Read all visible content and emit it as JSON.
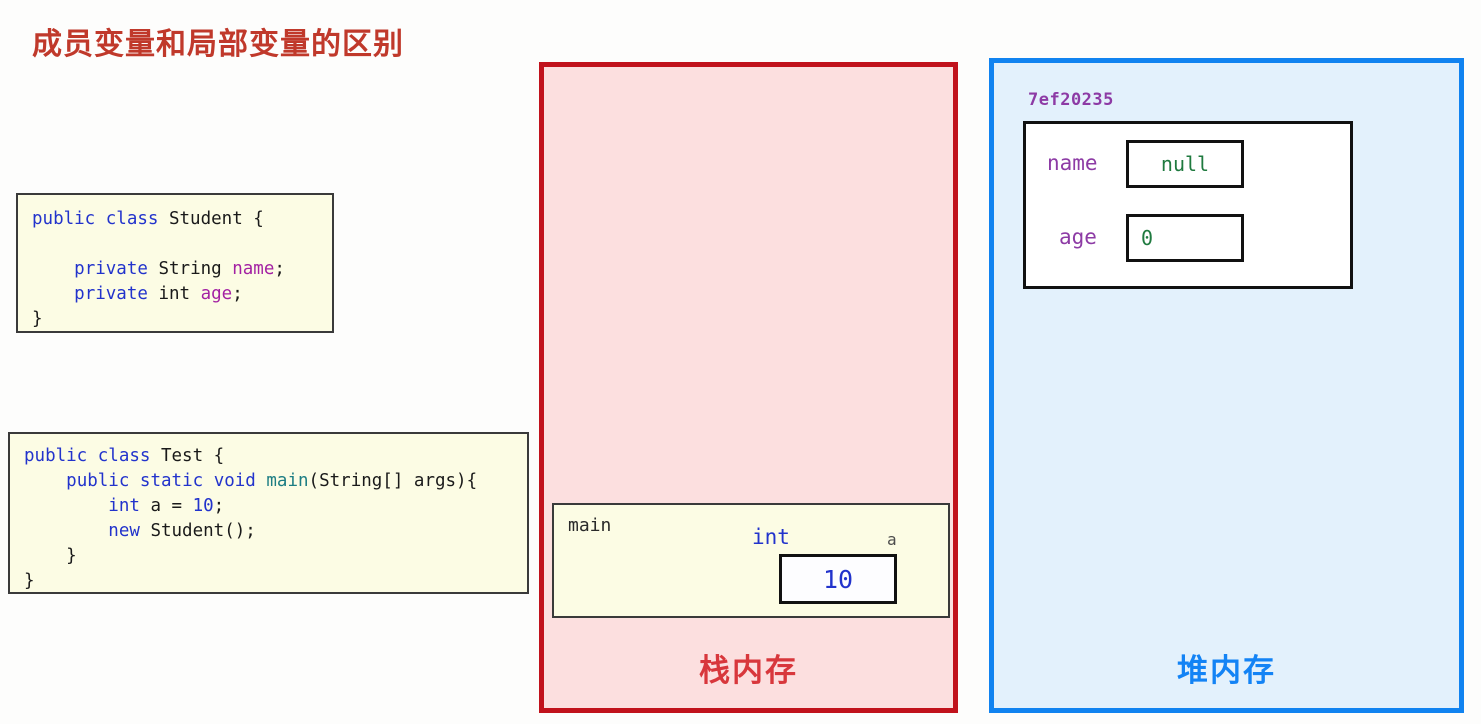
{
  "title": "成员变量和局部变量的区别",
  "colors": {
    "title": "#c0392b",
    "stack_border": "#c1121c",
    "stack_fill": "#fcdfdf",
    "heap_border": "#1183f0",
    "heap_fill": "#e3f1fc",
    "keyword": "#2233cc",
    "identifier": "#a321a3",
    "method": "#1c7d83",
    "heap_value": "#1f7a3f",
    "heap_address": "#8d3ba5"
  },
  "code_blocks": [
    {
      "name": "student-class",
      "lines": [
        [
          {
            "t": "public",
            "c": "kw"
          },
          {
            "t": " ",
            "c": "plain"
          },
          {
            "t": "class",
            "c": "kw"
          },
          {
            "t": " Student {",
            "c": "plain"
          }
        ],
        [],
        [
          {
            "t": "    ",
            "c": "plain"
          },
          {
            "t": "private",
            "c": "kw"
          },
          {
            "t": " String ",
            "c": "plain"
          },
          {
            "t": "name",
            "c": "ident"
          },
          {
            "t": ";",
            "c": "plain"
          }
        ],
        [
          {
            "t": "    ",
            "c": "plain"
          },
          {
            "t": "private",
            "c": "kw"
          },
          {
            "t": " int ",
            "c": "plain"
          },
          {
            "t": "age",
            "c": "ident"
          },
          {
            "t": ";",
            "c": "plain"
          }
        ],
        [
          {
            "t": "}",
            "c": "plain"
          }
        ]
      ]
    },
    {
      "name": "test-class",
      "lines": [
        [
          {
            "t": "public",
            "c": "kw"
          },
          {
            "t": " ",
            "c": "plain"
          },
          {
            "t": "class",
            "c": "kw"
          },
          {
            "t": " Test {",
            "c": "plain"
          }
        ],
        [
          {
            "t": "    ",
            "c": "plain"
          },
          {
            "t": "public",
            "c": "kw"
          },
          {
            "t": " ",
            "c": "plain"
          },
          {
            "t": "static",
            "c": "kw"
          },
          {
            "t": " ",
            "c": "plain"
          },
          {
            "t": "void",
            "c": "kw"
          },
          {
            "t": " ",
            "c": "plain"
          },
          {
            "t": "main",
            "c": "meth"
          },
          {
            "t": "(String[] args){",
            "c": "plain"
          }
        ],
        [
          {
            "t": "        ",
            "c": "plain"
          },
          {
            "t": "int",
            "c": "kw"
          },
          {
            "t": " a = ",
            "c": "plain"
          },
          {
            "t": "10",
            "c": "num"
          },
          {
            "t": ";",
            "c": "plain"
          }
        ],
        [
          {
            "t": "        ",
            "c": "plain"
          },
          {
            "t": "new",
            "c": "kw"
          },
          {
            "t": " Student();",
            "c": "plain"
          }
        ],
        [
          {
            "t": "    }",
            "c": "plain"
          }
        ],
        [
          {
            "t": "}",
            "c": "plain"
          }
        ]
      ]
    }
  ],
  "stack": {
    "label": "栈内存",
    "frame": {
      "name": "main",
      "variable": {
        "type": "int",
        "name": "a",
        "value": "10"
      }
    }
  },
  "heap": {
    "label": "堆内存",
    "object": {
      "address": "7ef20235",
      "fields": [
        {
          "name": "name",
          "value": "null"
        },
        {
          "name": "age",
          "value": "0"
        }
      ]
    }
  }
}
